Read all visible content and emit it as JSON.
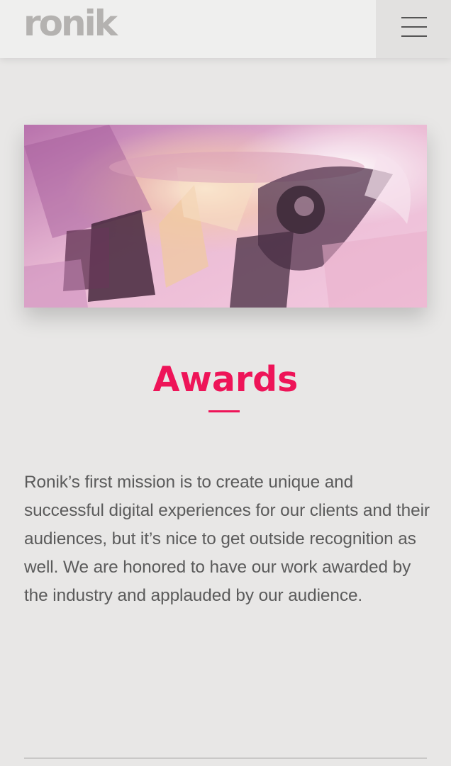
{
  "header": {
    "logo_text": "ronik",
    "menu_icon": "hamburger-menu-icon"
  },
  "hero": {
    "image": "pink-abstract-trophy-awards-image"
  },
  "main": {
    "title": "Awards",
    "body": "Ronik’s first mission is to create unique and successful digital experiences for our clients and their audiences, but it’s nice to get outside recognition as well. We are honored to have our work awarded by the industry and applauded by our audience."
  },
  "colors": {
    "accent": "#ee1458",
    "background": "#e8e7e6",
    "text": "#5b5b5b",
    "logo": "#b4b2b0"
  }
}
